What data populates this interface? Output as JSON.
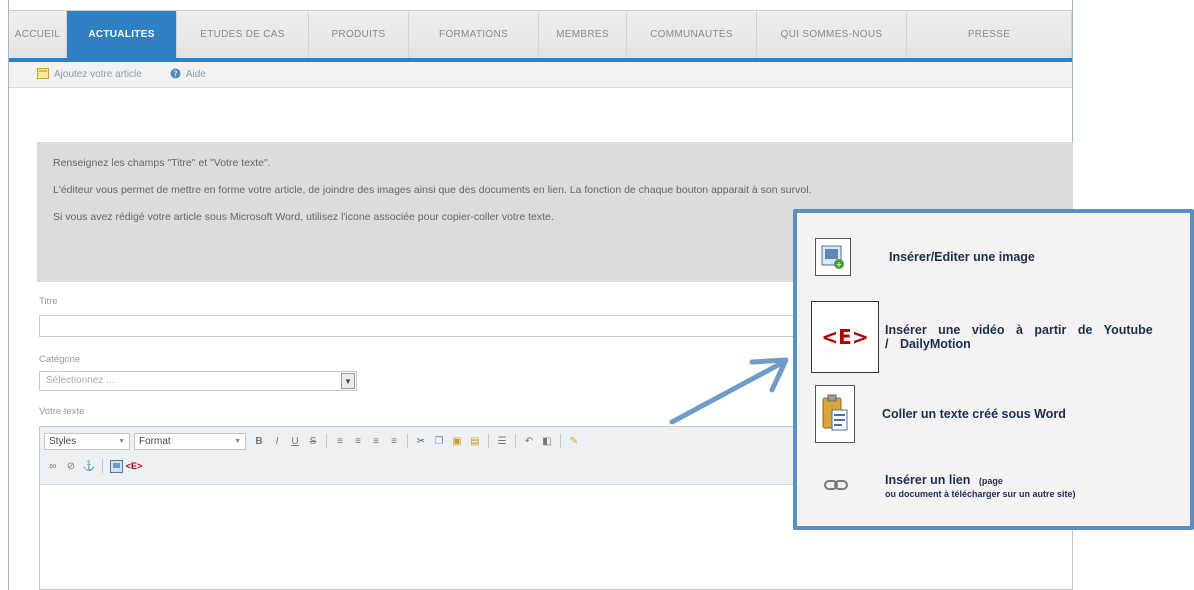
{
  "nav": {
    "tabs": [
      {
        "label": "ACCUEIL",
        "active": false
      },
      {
        "label": "ACTUALITES",
        "active": true
      },
      {
        "label": "ETUDES DE CAS",
        "active": false
      },
      {
        "label": "PRODUITS",
        "active": false
      },
      {
        "label": "FORMATIONS",
        "active": false
      },
      {
        "label": "MEMBRES",
        "active": false
      },
      {
        "label": "COMMUNAUTÉS",
        "active": false
      },
      {
        "label": "QUI SOMMES-NOUS",
        "active": false
      },
      {
        "label": "PRESSE",
        "active": false
      }
    ],
    "active_color": "#2f7fc2"
  },
  "subnav": {
    "add_article": "Ajoutez votre article",
    "help": "Aide"
  },
  "info": {
    "line1": "Renseignez les champs \"Titre\" et \"Votre texte\".",
    "line2": "L'éditeur vous permet de mettre en forme votre article, de joindre des images ainsi que des documents en lien. La fonction de chaque bouton apparait à son survol.",
    "line3": "Si vous avez rédigé votre article sous Microsoft Word, utilisez l'icone associée pour copier-coller votre texte."
  },
  "form": {
    "title_label": "Titre",
    "title_value": "",
    "category_label": "Catégorie",
    "category_value": "Sélectionnez ...",
    "text_label": "Votre texte",
    "styles_label": "Styles",
    "format_label": "Format"
  },
  "callout": {
    "border_color": "#5b8fc0",
    "image_text": "Insérer/Editer une image",
    "video_icon_text": "<E>",
    "video_text": "Insérer une vidéo à partir de Youtube / DailyMotion",
    "word_text": "Coller un texte  créé sous Word",
    "link_text": "Insérer un lien",
    "link_small_1": "(page",
    "link_small_2": "ou document à télécharger sur un autre site)"
  }
}
